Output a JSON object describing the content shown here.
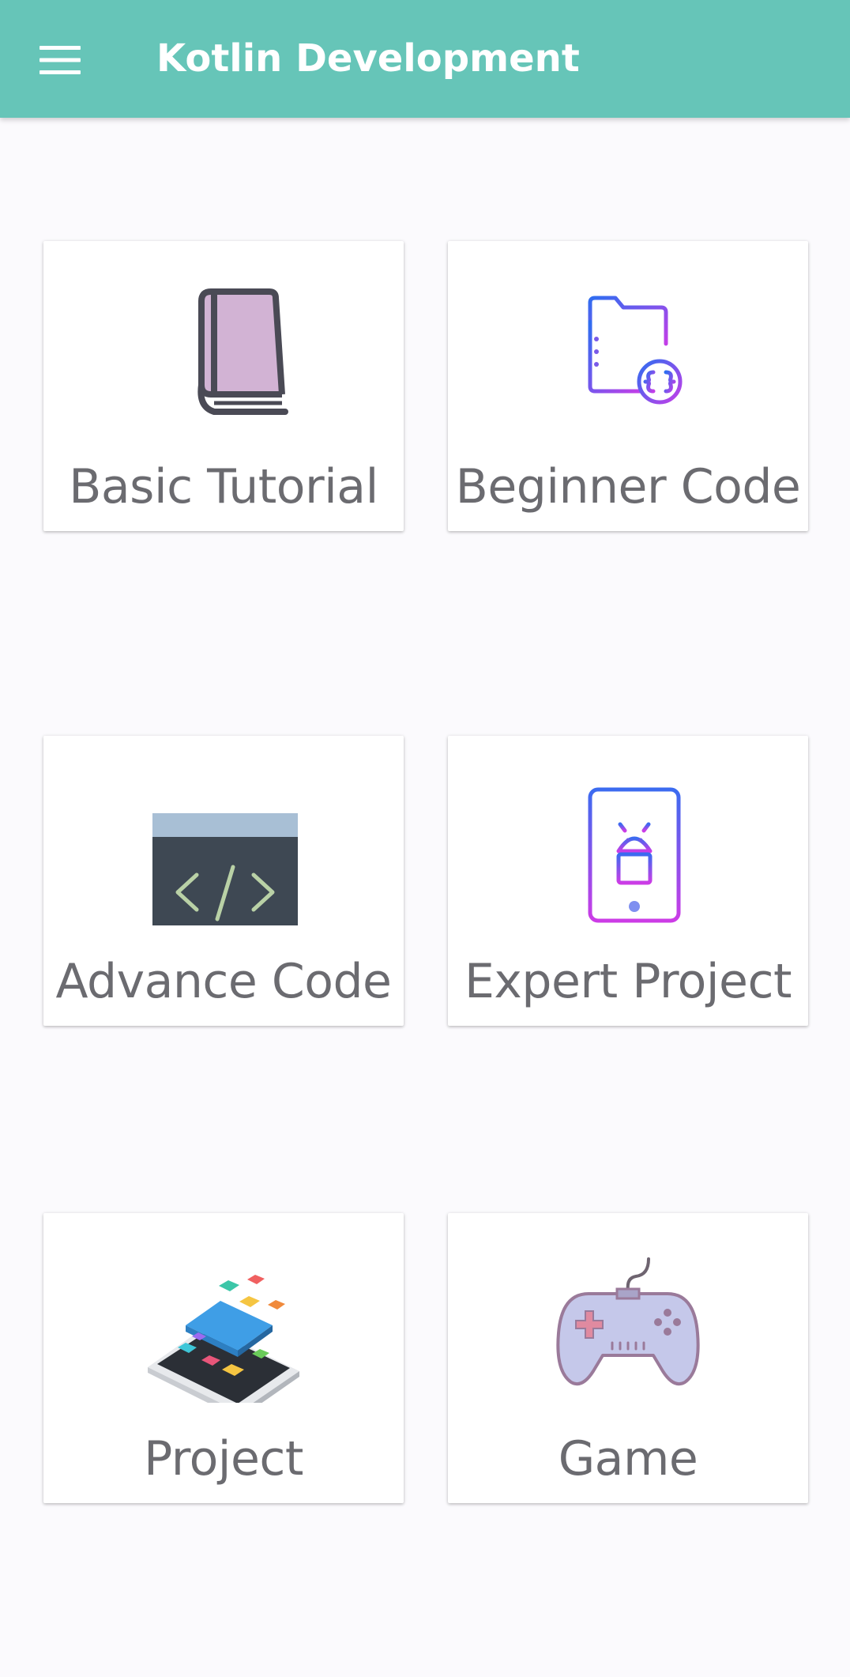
{
  "app_bar": {
    "title": "Kotlin Development",
    "menu_icon": "hamburger-menu-icon",
    "color": "#66c5b8"
  },
  "cards": [
    {
      "label": "Basic Tutorial",
      "icon": "book-icon"
    },
    {
      "label": "Beginner Code",
      "icon": "code-folder-icon"
    },
    {
      "label": "Advance Code",
      "icon": "code-window-icon"
    },
    {
      "label": "Expert Project",
      "icon": "android-phone-icon"
    },
    {
      "label": "Project",
      "icon": "app-phone-icon"
    },
    {
      "label": "Game",
      "icon": "gamepad-icon"
    }
  ],
  "colors": {
    "background": "#fbfafd",
    "card_label": "#6b6b70"
  }
}
